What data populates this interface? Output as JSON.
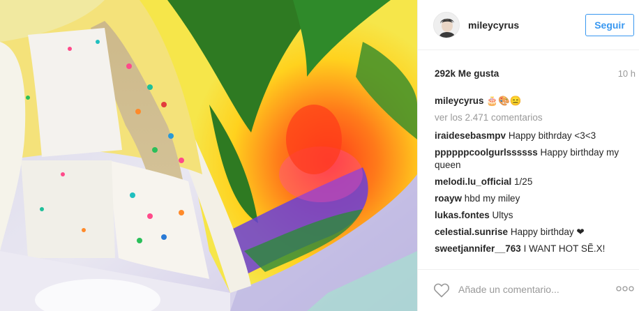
{
  "post": {
    "username": "mileycyrus",
    "follow_label": "Seguir",
    "likes": "292k Me gusta",
    "time": "10 h",
    "caption": {
      "user": "mileycyrus",
      "text": "🎂🎨😑"
    },
    "view_all": "ver los 2.471 comentarios",
    "comments": [
      {
        "user": "iraidesebasmpv",
        "text": "Happy bithrday <3<3"
      },
      {
        "user": "ppppppcoolgurlssssss",
        "text": "Happy birthday my queen"
      },
      {
        "user": "melodi.lu_official",
        "text": "1/25"
      },
      {
        "user": "roayw",
        "text": "hbd my miley"
      },
      {
        "user": "lukas.fontes",
        "text": "Ultys"
      },
      {
        "user": "celestial.sunrise",
        "text": "Happy birthday ❤"
      },
      {
        "user": "sweetjannifer__763",
        "text": "I WANT HOT SẼ.X!"
      }
    ],
    "add_comment_placeholder": "Añade un comentario..."
  },
  "icons": {
    "like": "heart-outline-icon",
    "more": "more-options-icon"
  },
  "colors": {
    "accent": "#3897f0",
    "muted": "#999999",
    "text": "#262626"
  }
}
